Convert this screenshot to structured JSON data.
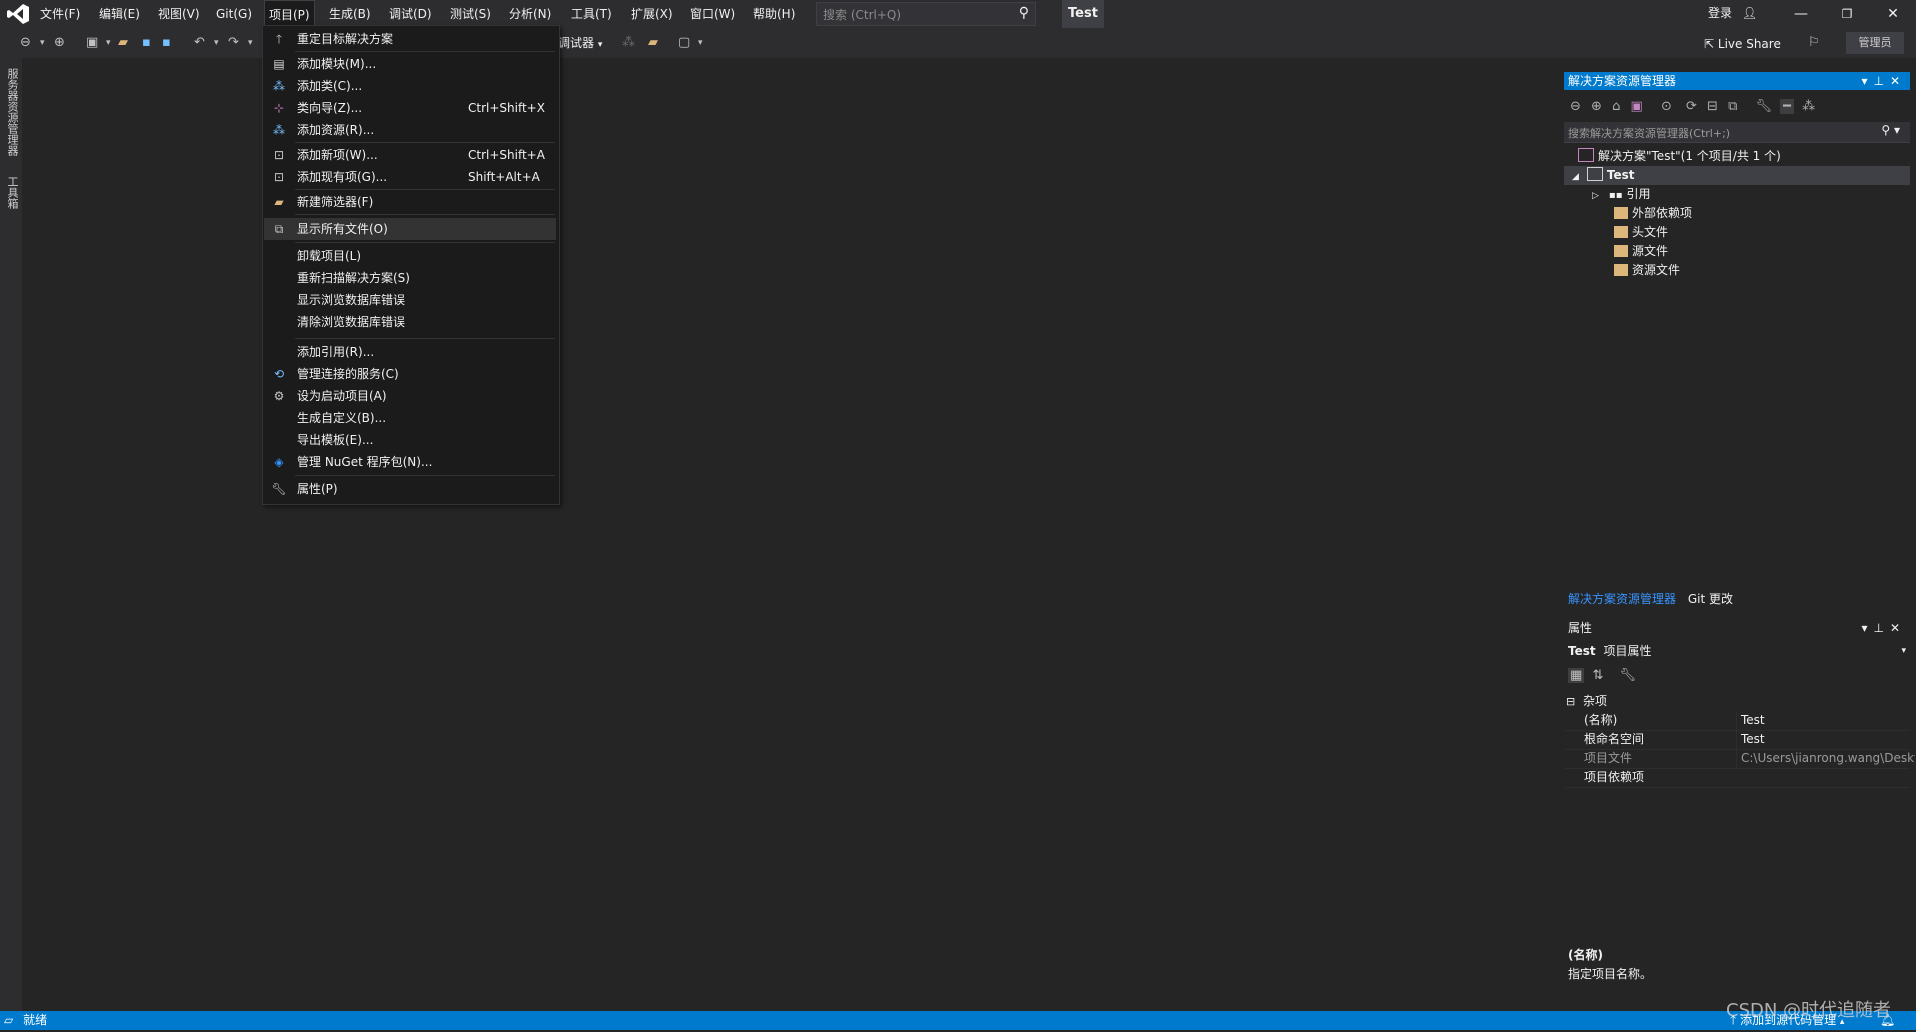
{
  "menubar": {
    "items": [
      "文件(F)",
      "编辑(E)",
      "视图(V)",
      "Git(G)",
      "项目(P)",
      "生成(B)",
      "调试(D)",
      "测试(S)",
      "分析(N)",
      "工具(T)",
      "扩展(X)",
      "窗口(W)",
      "帮助(H)"
    ],
    "active": "项目(P)",
    "search_placeholder": "搜索 (Ctrl+Q)",
    "app_title": "Test",
    "login": "登录"
  },
  "toolbar": {
    "debugger_label": "调试器",
    "live_share": "Live Share",
    "admin_badge": "管理员"
  },
  "left_tabs": [
    "服务器资源管理器",
    "工具箱"
  ],
  "project_menu": [
    {
      "label": "重定目标解决方案",
      "shortcut": "",
      "icon": "arrow-up-icon"
    },
    {
      "label": "添加模块(M)...",
      "shortcut": "",
      "icon": "add-module-icon"
    },
    {
      "label": "添加类(C)...",
      "shortcut": "",
      "icon": "add-class-icon"
    },
    {
      "label": "类向导(Z)...",
      "shortcut": "Ctrl+Shift+X",
      "icon": "class-wizard-icon"
    },
    {
      "label": "添加资源(R)...",
      "shortcut": "",
      "icon": "add-resource-icon"
    },
    {
      "label": "添加新项(W)...",
      "shortcut": "Ctrl+Shift+A",
      "icon": "add-new-item-icon"
    },
    {
      "label": "添加现有项(G)...",
      "shortcut": "Shift+Alt+A",
      "icon": "add-existing-item-icon"
    },
    {
      "label": "新建筛选器(F)",
      "shortcut": "",
      "icon": "new-filter-icon"
    },
    {
      "label": "显示所有文件(O)",
      "shortcut": "",
      "icon": "show-all-files-icon"
    },
    {
      "label": "卸载项目(L)",
      "shortcut": "",
      "icon": ""
    },
    {
      "label": "重新扫描解决方案(S)",
      "shortcut": "",
      "icon": ""
    },
    {
      "label": "显示浏览数据库错误",
      "shortcut": "",
      "icon": ""
    },
    {
      "label": "清除浏览数据库错误",
      "shortcut": "",
      "icon": ""
    },
    {
      "label": "添加引用(R)...",
      "shortcut": "",
      "icon": ""
    },
    {
      "label": "管理连接的服务(C)",
      "shortcut": "",
      "icon": "connected-services-icon"
    },
    {
      "label": "设为启动项目(A)",
      "shortcut": "",
      "icon": "gear-icon"
    },
    {
      "label": "生成自定义(B)...",
      "shortcut": "",
      "icon": ""
    },
    {
      "label": "导出模板(E)...",
      "shortcut": "",
      "icon": ""
    },
    {
      "label": "管理 NuGet 程序包(N)...",
      "shortcut": "",
      "icon": "nuget-icon"
    },
    {
      "label": "属性(P)",
      "shortcut": "",
      "icon": "wrench-icon"
    }
  ],
  "solution_explorer": {
    "title": "解决方案资源管理器",
    "search_placeholder": "搜索解决方案资源管理器(Ctrl+;)",
    "tree": [
      {
        "label": "解决方案\"Test\"(1 个项目/共 1 个)"
      },
      {
        "label": "Test"
      },
      {
        "label": "引用"
      },
      {
        "label": "外部依赖项"
      },
      {
        "label": "头文件"
      },
      {
        "label": "源文件"
      },
      {
        "label": "资源文件"
      }
    ],
    "tabs": [
      "解决方案资源管理器",
      "Git 更改"
    ]
  },
  "properties": {
    "title": "属性",
    "object_name": "Test",
    "object_type": "项目属性",
    "category": "杂项",
    "rows": [
      {
        "key": "(名称)",
        "value": "Test"
      },
      {
        "key": "根命名空间",
        "value": "Test"
      },
      {
        "key": "项目文件",
        "value": "C:\\Users\\jianrong.wang\\Deskt"
      },
      {
        "key": "项目依赖项",
        "value": ""
      }
    ],
    "desc_title": "(名称)",
    "desc_text": "指定项目名称。"
  },
  "status": {
    "ready": "就绪",
    "source_control": "添加到源代码管理",
    "watermark": "CSDN @时代追随者"
  },
  "colors": {
    "accent": "#007acc",
    "menu_bg": "#1b1b1c",
    "chrome": "#2d2d30",
    "editor": "#252526"
  }
}
